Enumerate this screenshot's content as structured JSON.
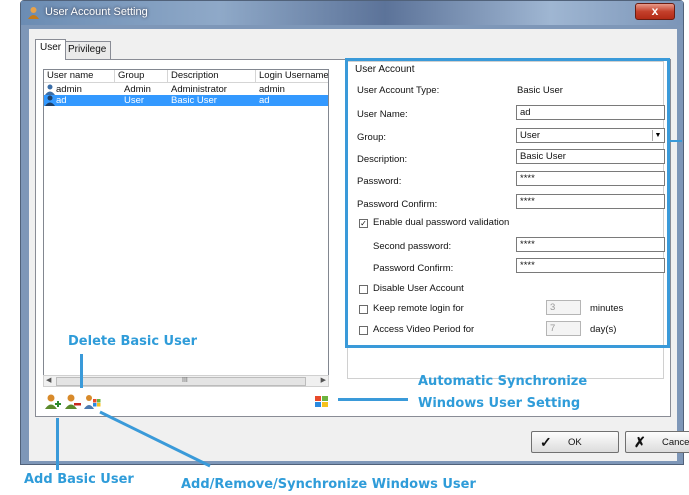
{
  "window": {
    "title": "User Account Setting",
    "close_label": "x"
  },
  "tabs": [
    {
      "label": "User",
      "active": true
    },
    {
      "label": "Privilege",
      "active": false
    }
  ],
  "user_list": {
    "columns": [
      "User name",
      "Group",
      "Description",
      "Login Username"
    ],
    "rows": [
      {
        "name": "admin",
        "group": "Admin",
        "description": "Administrator",
        "login": "admin",
        "selected": false
      },
      {
        "name": "ad",
        "group": "User",
        "description": "Basic User",
        "login": "ad",
        "selected": true
      }
    ],
    "scroll_grip": "III"
  },
  "toolbar": {
    "add_icon": "user-add-icon",
    "delete_icon": "user-delete-icon",
    "windows_users_icon": "windows-users-icon",
    "sync_icon": "windows-sync-icon"
  },
  "account": {
    "group_title": "User Account",
    "type_label": "User Account Type:",
    "type_value": "Basic User",
    "name_label": "User Name:",
    "name_value": "ad",
    "group_label": "Group:",
    "group_value": "User",
    "description_label": "Description:",
    "description_value": "Basic User",
    "password_label": "Password:",
    "password_value": "****",
    "password_confirm_label": "Password Confirm:",
    "password_confirm_value": "****",
    "dual_label": "Enable dual password validation",
    "dual_checked": true,
    "second_password_label": "Second password:",
    "second_password_value": "****",
    "second_confirm_label": "Password Confirm:",
    "second_confirm_value": "****",
    "disable_label": "Disable User Account",
    "keep_remote_label": "Keep remote login for",
    "keep_remote_value": "3",
    "keep_remote_unit": "minutes",
    "access_video_label": "Access Video Period for",
    "access_video_value": "7",
    "access_video_unit": "day(s)"
  },
  "buttons": {
    "ok": "OK",
    "cancel": "Cancel"
  },
  "annotations": {
    "delete_basic_user": "Delete Basic User",
    "auto_sync_line1": "Automatic Synchronize",
    "auto_sync_line2": "Windows User Setting",
    "add_basic_user": "Add Basic User",
    "add_remove_sync": "Add/Remove/Synchronize Windows User"
  },
  "colors": {
    "annotation": "#2f9cd9",
    "selection": "#3399ff"
  }
}
